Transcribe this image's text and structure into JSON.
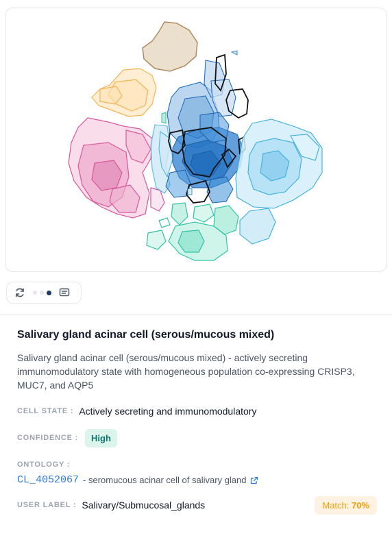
{
  "plot": {
    "colors": {
      "tan": "#b08a5e",
      "orange": "#f5b34f",
      "pink": "#d7589a",
      "blue_dark": "#1f6fc0",
      "blue_mid": "#3d8fd6",
      "blue_light": "#4fb8e4",
      "teal": "#2fc4a4",
      "outline_black": "#111111"
    }
  },
  "controls": {
    "refresh_icon": "refresh-icon",
    "comment_icon": "comment-icon",
    "dots_count": 3,
    "active_dot": 3
  },
  "details": {
    "title": "Salivary gland acinar cell (serous/mucous mixed)",
    "description": "Salivary gland acinar cell (serous/mucous mixed) - actively secreting immunomodulatory state with homogeneous population co-expressing CRISP3, MUC7, and AQP5",
    "cell_state_label": "CELL STATE :",
    "cell_state_value": "Actively secreting and immunomodulatory",
    "confidence_label": "CONFIDENCE :",
    "confidence_value": "High",
    "ontology_label": "ONTOLOGY :",
    "ontology_id": "CL_4052067",
    "ontology_desc": "- seromucous acinar cell of salivary gland",
    "user_label_label": "USER LABEL :",
    "user_label_value": "Salivary/Submucosal_glands",
    "match_prefix": "Match:",
    "match_value": "70%"
  }
}
